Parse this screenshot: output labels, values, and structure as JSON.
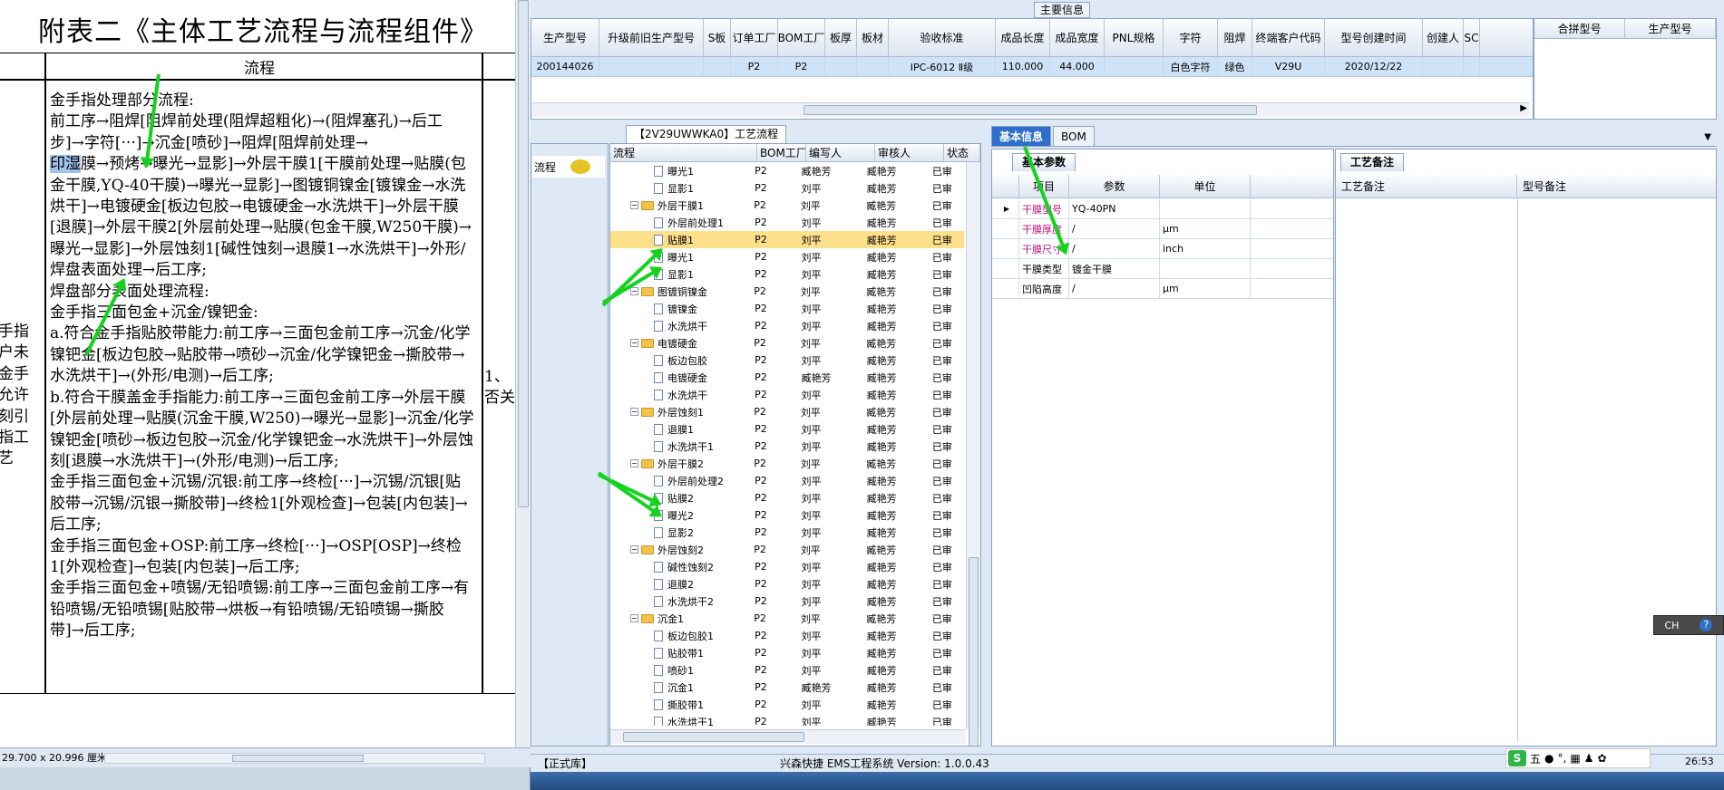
{
  "doc": {
    "title": "附表二《主体工艺流程与流程组件》",
    "col_header": "流程",
    "left_col_text": [
      "手指",
      "户未",
      "金手",
      "允许",
      "刻引",
      "指工艺"
    ],
    "right_col_text": [
      "1、",
      "否关"
    ],
    "paragraphs": [
      "金手指处理部分流程:",
      "前工序→阻焊[阻焊前处理(阻焊超粗化)→(阻焊塞孔)→后工步]→字符[···]→沉金[喷砂]→阻焊[阻焊前处理→",
      "印湿膜→预烤→曝光→显影]→外层干膜1[干膜前处理→贴膜(包金干膜,YQ-40干膜)→曝光→显影]→图镀铜镍金[镀镍金→水洗烘干]→电镀硬金[板边包胶→电镀硬金→水洗烘干]→外层干膜[退膜]→外层干膜2[外层前处理→贴膜(包金干膜,W250干膜)→曝光→显影]→外层蚀刻1[碱性蚀刻→退膜1→水洗烘干]→外形/焊盘表面处理→后工序;",
      "焊盘部分表面处理流程:",
      "金手指三面包金+沉金/镍钯金:",
      "a.符合金手指贴胶带能力:前工序→三面包金前工序→沉金/化学镍钯金[板边包胶→贴胶带→喷砂→沉金/化学镍钯金→撕胶带→水洗烘干]→(外形/电测)→后工序;",
      "b.符合干膜盖金手指能力:前工序→三面包金前工序→外层干膜[外层前处理→贴膜(沉金干膜,W250)→曝光→显影]→沉金/化学镍钯金[喷砂→板边包胶→沉金/化学镍钯金→水洗烘干]→外层蚀刻[退膜→水洗烘干]→(外形/电测)→后工序;",
      "金手指三面包金+沉锡/沉银:前工序→终检[···]→沉锡/沉银[贴胶带→沉锡/沉银→撕胶带]→终检1[外观检查]→包装[内包装]→后工序;",
      "金手指三面包金+OSP:前工序→终检[···]→OSP[OSP]→终检1[外观检查]→包装[内包装]→后工序;",
      "金手指三面包金+喷锡/无铅喷锡:前工序→三面包金前工序→有铅喷锡/无铅喷锡[贴胶带→烘板→有铅喷锡/无铅喷锡→撕胶带]→后工序;"
    ],
    "highlight_word": "印湿",
    "status": "29.700 x 20.996 厘米"
  },
  "top": {
    "section_label": "主要信息",
    "headers": [
      "生产型号",
      "升级前旧生产型号",
      "S板",
      "订单工厂",
      "BOM工厂",
      "板厚",
      "板材",
      "验收标准",
      "成品长度",
      "成品宽度",
      "PNL规格",
      "字符",
      "阻焊",
      "终端客户代码",
      "型号创建时间",
      "创建人",
      "SC"
    ],
    "row": [
      "200144026",
      "",
      "",
      "P2",
      "P2",
      "",
      "",
      "IPC-6012 Ⅱ级",
      "110.000",
      "44.000",
      "",
      "白色字符",
      "绿色",
      "V29U",
      "2020/12/22",
      "",
      ""
    ],
    "merge_headers": [
      "合拼型号",
      "生产型号"
    ]
  },
  "flow": {
    "tab": "【2V29UWWKA0】工艺流程",
    "side_item": "流程",
    "headers": [
      "流程",
      "BOM工厂",
      "编写人",
      "审核人",
      "状态"
    ],
    "rows": [
      {
        "name": "曝光1",
        "level": 2,
        "folder": false,
        "bom": "P2",
        "writer": "臧艳芳",
        "reviewer": "臧艳芳",
        "status": "已审",
        "sel": false
      },
      {
        "name": "显影1",
        "level": 2,
        "folder": false,
        "bom": "P2",
        "writer": "刘平",
        "reviewer": "臧艳芳",
        "status": "已审",
        "sel": false
      },
      {
        "name": "外层干膜1",
        "level": 1,
        "folder": true,
        "bom": "P2",
        "writer": "刘平",
        "reviewer": "臧艳芳",
        "status": "已审",
        "sel": false
      },
      {
        "name": "外层前处理1",
        "level": 2,
        "folder": false,
        "bom": "P2",
        "writer": "刘平",
        "reviewer": "臧艳芳",
        "status": "已审",
        "sel": false
      },
      {
        "name": "贴膜1",
        "level": 2,
        "folder": false,
        "bom": "P2",
        "writer": "刘平",
        "reviewer": "臧艳芳",
        "status": "已审",
        "sel": true
      },
      {
        "name": "曝光1",
        "level": 2,
        "folder": false,
        "bom": "P2",
        "writer": "刘平",
        "reviewer": "臧艳芳",
        "status": "已审",
        "sel": false
      },
      {
        "name": "显影1",
        "level": 2,
        "folder": false,
        "bom": "P2",
        "writer": "刘平",
        "reviewer": "臧艳芳",
        "status": "已审",
        "sel": false
      },
      {
        "name": "图镀铜镍金",
        "level": 1,
        "folder": true,
        "bom": "P2",
        "writer": "刘平",
        "reviewer": "臧艳芳",
        "status": "已审",
        "sel": false
      },
      {
        "name": "镀镍金",
        "level": 2,
        "folder": false,
        "bom": "P2",
        "writer": "刘平",
        "reviewer": "臧艳芳",
        "status": "已审",
        "sel": false
      },
      {
        "name": "水洗烘干",
        "level": 2,
        "folder": false,
        "bom": "P2",
        "writer": "刘平",
        "reviewer": "臧艳芳",
        "status": "已审",
        "sel": false
      },
      {
        "name": "电镀硬金",
        "level": 1,
        "folder": true,
        "bom": "P2",
        "writer": "刘平",
        "reviewer": "臧艳芳",
        "status": "已审",
        "sel": false
      },
      {
        "name": "板边包胶",
        "level": 2,
        "folder": false,
        "bom": "P2",
        "writer": "刘平",
        "reviewer": "臧艳芳",
        "status": "已审",
        "sel": false
      },
      {
        "name": "电镀硬金",
        "level": 2,
        "folder": false,
        "bom": "P2",
        "writer": "臧艳芳",
        "reviewer": "臧艳芳",
        "status": "已审",
        "sel": false
      },
      {
        "name": "水洗烘干",
        "level": 2,
        "folder": false,
        "bom": "P2",
        "writer": "刘平",
        "reviewer": "臧艳芳",
        "status": "已审",
        "sel": false
      },
      {
        "name": "外层蚀刻1",
        "level": 1,
        "folder": true,
        "bom": "P2",
        "writer": "刘平",
        "reviewer": "臧艳芳",
        "status": "已审",
        "sel": false
      },
      {
        "name": "退膜1",
        "level": 2,
        "folder": false,
        "bom": "P2",
        "writer": "刘平",
        "reviewer": "臧艳芳",
        "status": "已审",
        "sel": false
      },
      {
        "name": "水洗烘干1",
        "level": 2,
        "folder": false,
        "bom": "P2",
        "writer": "刘平",
        "reviewer": "臧艳芳",
        "status": "已审",
        "sel": false
      },
      {
        "name": "外层干膜2",
        "level": 1,
        "folder": true,
        "bom": "P2",
        "writer": "刘平",
        "reviewer": "臧艳芳",
        "status": "已审",
        "sel": false
      },
      {
        "name": "外层前处理2",
        "level": 2,
        "folder": false,
        "bom": "P2",
        "writer": "刘平",
        "reviewer": "臧艳芳",
        "status": "已审",
        "sel": false
      },
      {
        "name": "贴膜2",
        "level": 2,
        "folder": false,
        "bom": "P2",
        "writer": "刘平",
        "reviewer": "臧艳芳",
        "status": "已审",
        "sel": false
      },
      {
        "name": "曝光2",
        "level": 2,
        "folder": false,
        "bom": "P2",
        "writer": "刘平",
        "reviewer": "臧艳芳",
        "status": "已审",
        "sel": false
      },
      {
        "name": "显影2",
        "level": 2,
        "folder": false,
        "bom": "P2",
        "writer": "刘平",
        "reviewer": "臧艳芳",
        "status": "已审",
        "sel": false
      },
      {
        "name": "外层蚀刻2",
        "level": 1,
        "folder": true,
        "bom": "P2",
        "writer": "刘平",
        "reviewer": "臧艳芳",
        "status": "已审",
        "sel": false
      },
      {
        "name": "碱性蚀刻2",
        "level": 2,
        "folder": false,
        "bom": "P2",
        "writer": "刘平",
        "reviewer": "臧艳芳",
        "status": "已审",
        "sel": false
      },
      {
        "name": "退膜2",
        "level": 2,
        "folder": false,
        "bom": "P2",
        "writer": "刘平",
        "reviewer": "臧艳芳",
        "status": "已审",
        "sel": false
      },
      {
        "name": "水洗烘干2",
        "level": 2,
        "folder": false,
        "bom": "P2",
        "writer": "刘平",
        "reviewer": "臧艳芳",
        "status": "已审",
        "sel": false
      },
      {
        "name": "沉金1",
        "level": 1,
        "folder": true,
        "bom": "P2",
        "writer": "刘平",
        "reviewer": "臧艳芳",
        "status": "已审",
        "sel": false
      },
      {
        "name": "板边包胶1",
        "level": 2,
        "folder": false,
        "bom": "P2",
        "writer": "刘平",
        "reviewer": "臧艳芳",
        "status": "已审",
        "sel": false
      },
      {
        "name": "贴胶带1",
        "level": 2,
        "folder": false,
        "bom": "P2",
        "writer": "刘平",
        "reviewer": "臧艳芳",
        "status": "已审",
        "sel": false
      },
      {
        "name": "喷砂1",
        "level": 2,
        "folder": false,
        "bom": "P2",
        "writer": "刘平",
        "reviewer": "臧艳芳",
        "status": "已审",
        "sel": false
      },
      {
        "name": "沉金1",
        "level": 2,
        "folder": false,
        "bom": "P2",
        "writer": "臧艳芳",
        "reviewer": "臧艳芳",
        "status": "已审",
        "sel": false
      },
      {
        "name": "撕胶带1",
        "level": 2,
        "folder": false,
        "bom": "P2",
        "writer": "刘平",
        "reviewer": "臧艳芳",
        "status": "已审",
        "sel": false
      },
      {
        "name": "水洗烘干1",
        "level": 2,
        "folder": false,
        "bom": "P2",
        "writer": "刘平",
        "reviewer": "臧艳芳",
        "status": "已审",
        "sel": false
      }
    ]
  },
  "info": {
    "tabs": [
      "基本信息",
      "BOM"
    ],
    "param_tab": "基本参数",
    "param_headers": [
      "项目",
      "参数",
      "单位"
    ],
    "params": [
      {
        "item": "干膜型号",
        "value": "YQ-40PN",
        "unit": "",
        "pink": true
      },
      {
        "item": "干膜厚度",
        "value": "/",
        "unit": "μm",
        "pink": true
      },
      {
        "item": "干膜尺寸",
        "value": "/",
        "unit": "inch",
        "pink": true
      },
      {
        "item": "干膜类型",
        "value": "镀金干膜",
        "unit": "",
        "pink": false
      },
      {
        "item": "凹陷高度",
        "value": "/",
        "unit": "μm",
        "pink": false
      }
    ],
    "process_tab": "工艺备注",
    "process_headers": [
      "工艺备注",
      "型号备注"
    ]
  },
  "status": {
    "env": "【正式库】",
    "app": "兴森快捷 EMS工程系统 Version: 1.0.0.43",
    "ime": "CH",
    "clock": "26:53",
    "tray_label": "五"
  },
  "colors": {
    "accent": "#2f6fc9",
    "selected_row": "#ffe08a",
    "annotation_arrow": "#14d21e",
    "pink_label": "#c0147a"
  }
}
